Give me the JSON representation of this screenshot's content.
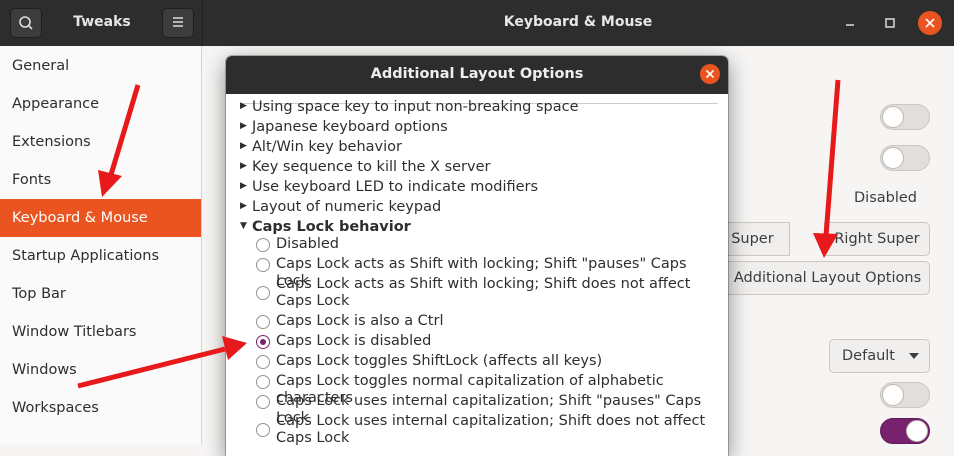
{
  "header": {
    "app_title": "Tweaks",
    "window_title": "Keyboard & Mouse"
  },
  "sidebar": {
    "items": [
      {
        "label": "General"
      },
      {
        "label": "Appearance"
      },
      {
        "label": "Extensions"
      },
      {
        "label": "Fonts"
      },
      {
        "label": "Keyboard & Mouse"
      },
      {
        "label": "Startup Applications"
      },
      {
        "label": "Top Bar"
      },
      {
        "label": "Window Titlebars"
      },
      {
        "label": "Windows"
      },
      {
        "label": "Workspaces"
      }
    ],
    "active": "Keyboard & Mouse"
  },
  "content": {
    "disabled_label": "Disabled",
    "left_super": "Left Super",
    "right_super": "Right Super",
    "additional_layout_button": "Additional Layout Options",
    "default_select": "Default"
  },
  "dialog": {
    "title": "Additional Layout Options",
    "collapsed_sections": [
      "Using space key to input non-breaking space",
      "Japanese keyboard options",
      "Alt/Win key behavior",
      "Key sequence to kill the X server",
      "Use keyboard LED to indicate modifiers",
      "Layout of numeric keypad"
    ],
    "expanded_section": "Caps Lock behavior",
    "caps_options": [
      {
        "label": "Disabled",
        "checked": false
      },
      {
        "label": "Caps Lock acts as Shift with locking; Shift \"pauses\" Caps Lock",
        "checked": false
      },
      {
        "label": "Caps Lock acts as Shift with locking; Shift does not affect Caps Lock",
        "checked": false
      },
      {
        "label": "Caps Lock is also a Ctrl",
        "checked": false
      },
      {
        "label": "Caps Lock is disabled",
        "checked": true
      },
      {
        "label": "Caps Lock toggles ShiftLock (affects all keys)",
        "checked": false
      },
      {
        "label": "Caps Lock toggles normal capitalization of alphabetic characters",
        "checked": false
      },
      {
        "label": "Caps Lock uses internal capitalization; Shift \"pauses\" Caps Lock",
        "checked": false
      },
      {
        "label": "Caps Lock uses internal capitalization; Shift does not affect Caps Lock",
        "checked": false
      }
    ]
  },
  "colors": {
    "accent": "#e95420",
    "radio_selected": "#77216f",
    "annotation_arrow": "#e8191b"
  }
}
